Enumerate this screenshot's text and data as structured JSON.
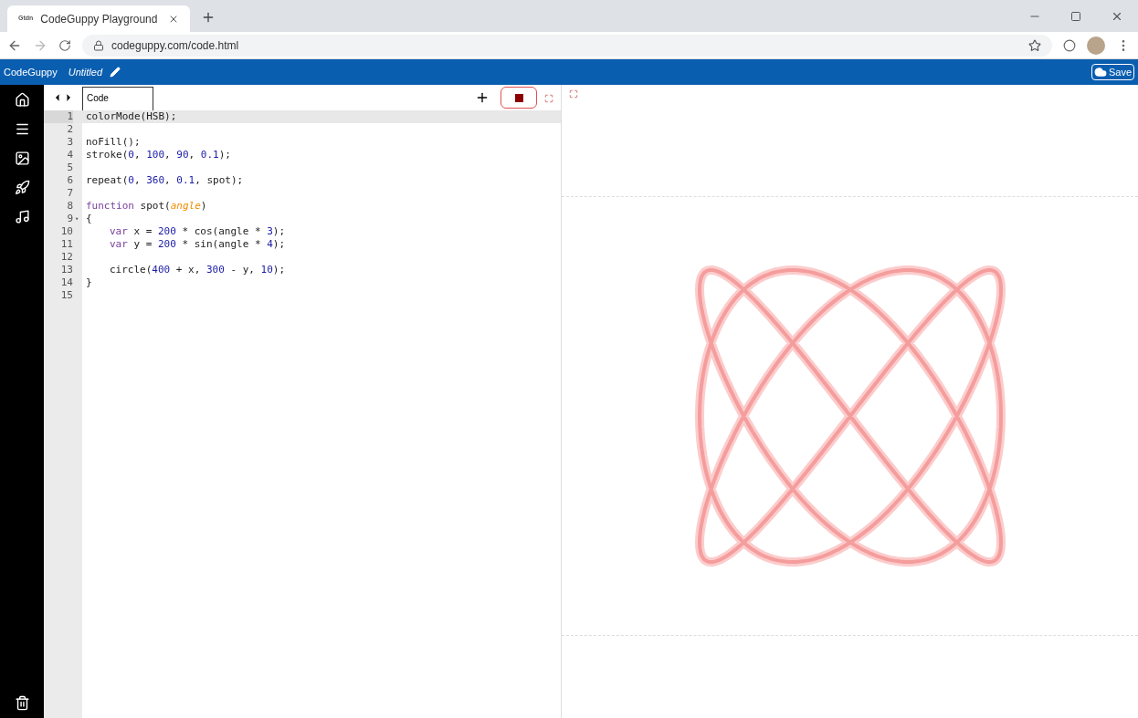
{
  "browser": {
    "tab_title": "CodeGuppy Playground",
    "tab_logo": "Gtdn",
    "url": "codeguppy.com/code.html"
  },
  "app_bar": {
    "brand": "CodeGuppy",
    "file_title": "Untitled",
    "save_label": "Save"
  },
  "editor": {
    "tab_label": "Code",
    "lines": [
      {
        "number": "1",
        "active": true,
        "indent": false,
        "tokens": [
          {
            "text": "colorMode(HSB);",
            "kind": "plain"
          }
        ]
      },
      {
        "number": "2",
        "active": false
      },
      {
        "number": "3",
        "active": false,
        "indent": false,
        "tokens": [
          {
            "text": "noFill();",
            "kind": "plain"
          }
        ]
      },
      {
        "number": "4",
        "active": false,
        "indent": false,
        "tokens": [
          {
            "text": "stroke(",
            "kind": "plain"
          },
          {
            "text": "0",
            "kind": "number"
          },
          {
            "text": ", ",
            "kind": "plain"
          },
          {
            "text": "100",
            "kind": "number"
          },
          {
            "text": ", ",
            "kind": "plain"
          },
          {
            "text": "90",
            "kind": "number"
          },
          {
            "text": ", ",
            "kind": "plain"
          },
          {
            "text": "0.1",
            "kind": "number"
          },
          {
            "text": ");",
            "kind": "plain"
          }
        ]
      },
      {
        "number": "5",
        "active": false
      },
      {
        "number": "6",
        "active": false,
        "indent": false,
        "tokens": [
          {
            "text": "repeat(",
            "kind": "plain"
          },
          {
            "text": "0",
            "kind": "number"
          },
          {
            "text": ", ",
            "kind": "plain"
          },
          {
            "text": "360",
            "kind": "number"
          },
          {
            "text": ", ",
            "kind": "plain"
          },
          {
            "text": "0.1",
            "kind": "number"
          },
          {
            "text": ", spot);",
            "kind": "plain"
          }
        ]
      },
      {
        "number": "7",
        "active": false
      },
      {
        "number": "8",
        "active": false,
        "indent": false,
        "tokens": [
          {
            "text": "function",
            "kind": "keyword"
          },
          {
            "text": " spot(",
            "kind": "plain"
          },
          {
            "text": "angle",
            "kind": "param"
          },
          {
            "text": ")",
            "kind": "plain"
          }
        ]
      },
      {
        "number": "9",
        "fold_marker": "▾",
        "active": false,
        "indent": false,
        "tokens": [
          {
            "text": "{",
            "kind": "plain"
          }
        ]
      },
      {
        "number": "10",
        "active": false,
        "indent": true,
        "tokens": [
          {
            "text": "var",
            "kind": "keyword"
          },
          {
            "text": " x = ",
            "kind": "plain"
          },
          {
            "text": "200",
            "kind": "number"
          },
          {
            "text": " * cos(angle * ",
            "kind": "plain"
          },
          {
            "text": "3",
            "kind": "number"
          },
          {
            "text": ");",
            "kind": "plain"
          }
        ]
      },
      {
        "number": "11",
        "active": false,
        "indent": true,
        "tokens": [
          {
            "text": "var",
            "kind": "keyword"
          },
          {
            "text": " y = ",
            "kind": "plain"
          },
          {
            "text": "200",
            "kind": "number"
          },
          {
            "text": " * sin(angle * ",
            "kind": "plain"
          },
          {
            "text": "4",
            "kind": "number"
          },
          {
            "text": ");",
            "kind": "plain"
          }
        ]
      },
      {
        "number": "12",
        "active": false
      },
      {
        "number": "13",
        "active": false,
        "indent": true,
        "tokens": [
          {
            "text": "circle(",
            "kind": "plain"
          },
          {
            "text": "400",
            "kind": "number"
          },
          {
            "text": " + x, ",
            "kind": "plain"
          },
          {
            "text": "300",
            "kind": "number"
          },
          {
            "text": " - y, ",
            "kind": "plain"
          },
          {
            "text": "10",
            "kind": "number"
          },
          {
            "text": ");",
            "kind": "plain"
          }
        ]
      },
      {
        "number": "14",
        "active": false,
        "indent": false,
        "tokens": [
          {
            "text": "}",
            "kind": "plain"
          }
        ]
      },
      {
        "number": "15",
        "active": false
      }
    ]
  }
}
